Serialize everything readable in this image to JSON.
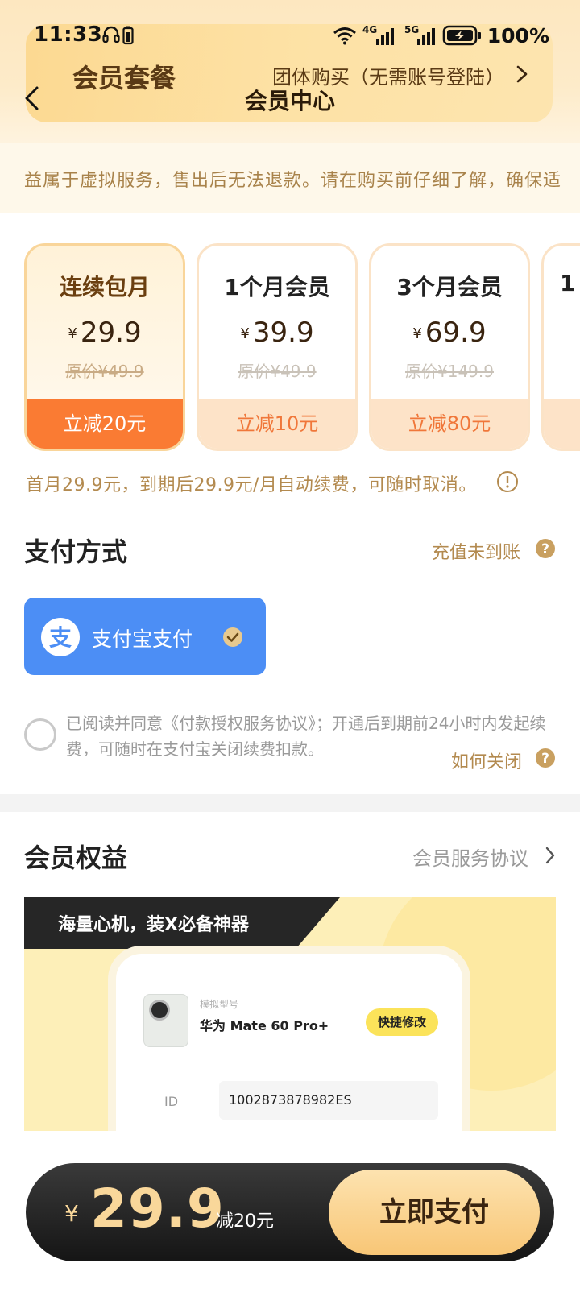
{
  "status_bar": {
    "time": "11:33",
    "battery_percent": "100%",
    "network_1": "4G",
    "network_2": "5G"
  },
  "header": {
    "card_title": "会员套餐",
    "card_right_link": "团体购买（无需账号登陆）",
    "page_title": "会员中心"
  },
  "notice": {
    "text": "益属于虚拟服务，售出后无法退款。请在购买前仔细了解，确保适"
  },
  "plans": [
    {
      "name": "连续包月",
      "currency": "¥",
      "price": "29.9",
      "original": "原价¥49.9",
      "discount": "立减20元",
      "selected": true
    },
    {
      "name": "1个月会员",
      "currency": "¥",
      "price": "39.9",
      "original": "原价¥49.9",
      "discount": "立减10元",
      "selected": false
    },
    {
      "name": "3个月会员",
      "currency": "¥",
      "price": "69.9",
      "original": "原价¥149.9",
      "discount": "立减80元",
      "selected": false
    },
    {
      "name": "1",
      "currency": "",
      "price": "",
      "original": "",
      "discount": "",
      "selected": false
    }
  ],
  "renew_note": "首月29.9元，到期后29.9元/月自动续费，可随时取消。",
  "payment": {
    "section_title": "支付方式",
    "recharge_link": "充值未到账",
    "method_label": "支付宝支付",
    "agree_text": "已阅读并同意《付款授权服务协议》；开通后到期前24小时内发起续费，可随时在支付宝关闭续费扣款。",
    "how_close": "如何关闭"
  },
  "benefits": {
    "section_title": "会员权益",
    "link": "会员服务协议",
    "banner_text": "海量心机，装X必备神器",
    "device_sub": "模拟型号",
    "device_name": "华为 Mate 60 Pro+",
    "quick_edit": "快捷修改",
    "id_label": "ID",
    "id_value": "1002873878982ES"
  },
  "pay_bar": {
    "currency": "¥",
    "amount": "29.9",
    "discount": "减20元",
    "button": "立即支付"
  },
  "colors": {
    "accent_orange": "#fa7b33",
    "gold_text": "#b38a4f",
    "alipay_blue": "#4c8ef5",
    "pay_bar_dark": "#151515"
  }
}
